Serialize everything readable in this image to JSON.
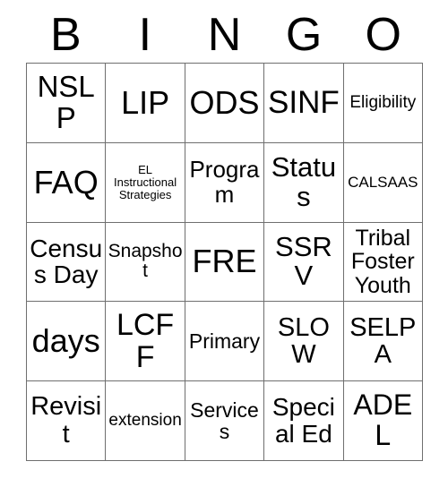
{
  "card": {
    "header_letters": [
      "B",
      "I",
      "N",
      "G",
      "O"
    ],
    "columns": 5,
    "rows": 5,
    "border_color": "#6f6f6f",
    "background_color": "#ffffff",
    "text_color": "#000000",
    "cells": [
      [
        {
          "text": "NSLP",
          "size": "fs-33"
        },
        {
          "text": "LIP",
          "size": "fs-36"
        },
        {
          "text": "ODS",
          "size": "fs-36"
        },
        {
          "text": "SINF",
          "size": "fs-35"
        },
        {
          "text": "Eligibility",
          "size": "fs-19"
        }
      ],
      [
        {
          "text": "FAQ",
          "size": "fs-36"
        },
        {
          "text": "EL Instructional Strategies",
          "size": "fs-13"
        },
        {
          "text": "Program",
          "size": "fs-26"
        },
        {
          "text": "Status",
          "size": "fs-31"
        },
        {
          "text": "CALSAAS",
          "size": "fs-17"
        }
      ],
      [
        {
          "text": "Census Day",
          "size": "fs-28"
        },
        {
          "text": "Snapshot",
          "size": "fs-21"
        },
        {
          "text": "FRE",
          "size": "fs-36"
        },
        {
          "text": "SSRV",
          "size": "fs-31"
        },
        {
          "text": "Tribal Foster Youth",
          "size": "fs-25"
        }
      ],
      [
        {
          "text": "days",
          "size": "fs-36"
        },
        {
          "text": "LCFF",
          "size": "fs-34"
        },
        {
          "text": "Primary",
          "size": "fs-23"
        },
        {
          "text": "SLOW",
          "size": "fs-29"
        },
        {
          "text": "SELPA",
          "size": "fs-29"
        }
      ],
      [
        {
          "text": "Revisit",
          "size": "fs-29"
        },
        {
          "text": "extension",
          "size": "fs-19"
        },
        {
          "text": "Services",
          "size": "fs-23"
        },
        {
          "text": "Special Ed",
          "size": "fs-28"
        },
        {
          "text": "ADEL",
          "size": "fs-32"
        }
      ]
    ]
  }
}
